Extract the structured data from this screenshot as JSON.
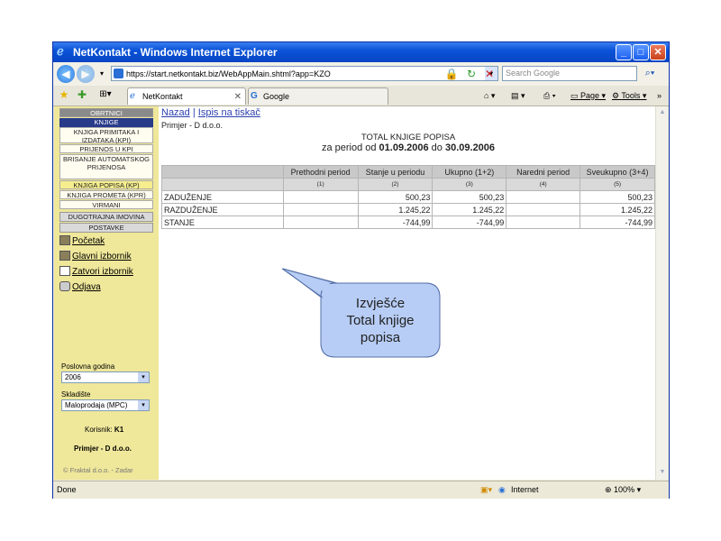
{
  "window": {
    "title": "NetKontakt - Windows Internet Explorer",
    "url": "https://start.netkontakt.biz/WebAppMain.shtml?app=KZO",
    "search_placeholder": "Search Google",
    "tabs": [
      {
        "label": "NetKontakt"
      },
      {
        "label": "Google"
      }
    ],
    "tools": {
      "page": "Page",
      "tools": "Tools"
    },
    "status_left": "Done",
    "status_zone": "Internet",
    "zoom": "100%"
  },
  "sidebar": {
    "header": "OBRTNICI",
    "items": [
      {
        "label": "KNJIGE",
        "style": "blue"
      },
      {
        "label": "KNJIGA PRIMITAKA I IZDATAKA (KPI)",
        "style": "item"
      },
      {
        "label": "PRIJENOS U KPI",
        "style": "item"
      },
      {
        "label": "BRISANJE AUTOMATSKOG PRIJENOSA",
        "style": "item"
      },
      {
        "label": "KNJIGA POPISA (KP)",
        "style": "hl"
      },
      {
        "label": "KNJIGA PROMETA (KPR)",
        "style": "item"
      },
      {
        "label": "VIRMANI",
        "style": "item"
      },
      {
        "label": "DUGOTRAJNA IMOVINA",
        "style": "grey"
      },
      {
        "label": "POSTAVKE",
        "style": "grey"
      }
    ],
    "links": [
      "Početak",
      "Glavni izbornik",
      "Zatvori izbornik",
      "Odjava"
    ],
    "year_label": "Poslovna godina",
    "year_value": "2006",
    "warehouse_label": "Skladište",
    "warehouse_value": "Maloprodaja (MPC)",
    "user_label": "Korisnik:",
    "user_value": "K1",
    "company": "Primjer - D d.o.o.",
    "footer": "© Fraktal d.o.o. - Zadar"
  },
  "main": {
    "links": [
      "Nazad",
      "Ispis na tiskač"
    ],
    "firm": "Primjer - D d.o.o.",
    "title": "TOTAL KNJIGE POPISA",
    "period_prefix": "za period od",
    "date_from": "01.09.2006",
    "period_mid": "do",
    "date_to": "30.09.2006",
    "columns": [
      "",
      "Prethodni period",
      "Stanje u periodu",
      "Ukupno (1+2)",
      "Naredni period",
      "Sveukupno (3+4)"
    ],
    "column_numbers": [
      "",
      "(1)",
      "(2)",
      "(3)",
      "(4)",
      "(5)"
    ],
    "rows": [
      {
        "label": "ZADUŽENJE",
        "c1": "",
        "c2": "500,23",
        "c3": "500,23",
        "c4": "",
        "c5": "500,23"
      },
      {
        "label": "RAZDUŽENJE",
        "c1": "",
        "c2": "1.245,22",
        "c3": "1.245,22",
        "c4": "",
        "c5": "1.245,22"
      },
      {
        "label": "STANJE",
        "c1": "",
        "c2": "-744,99",
        "c3": "-744,99",
        "c4": "",
        "c5": "-744,99"
      }
    ]
  },
  "callout": {
    "line1": "Izvješće",
    "line2": "Total knjige",
    "line3": "popisa"
  }
}
